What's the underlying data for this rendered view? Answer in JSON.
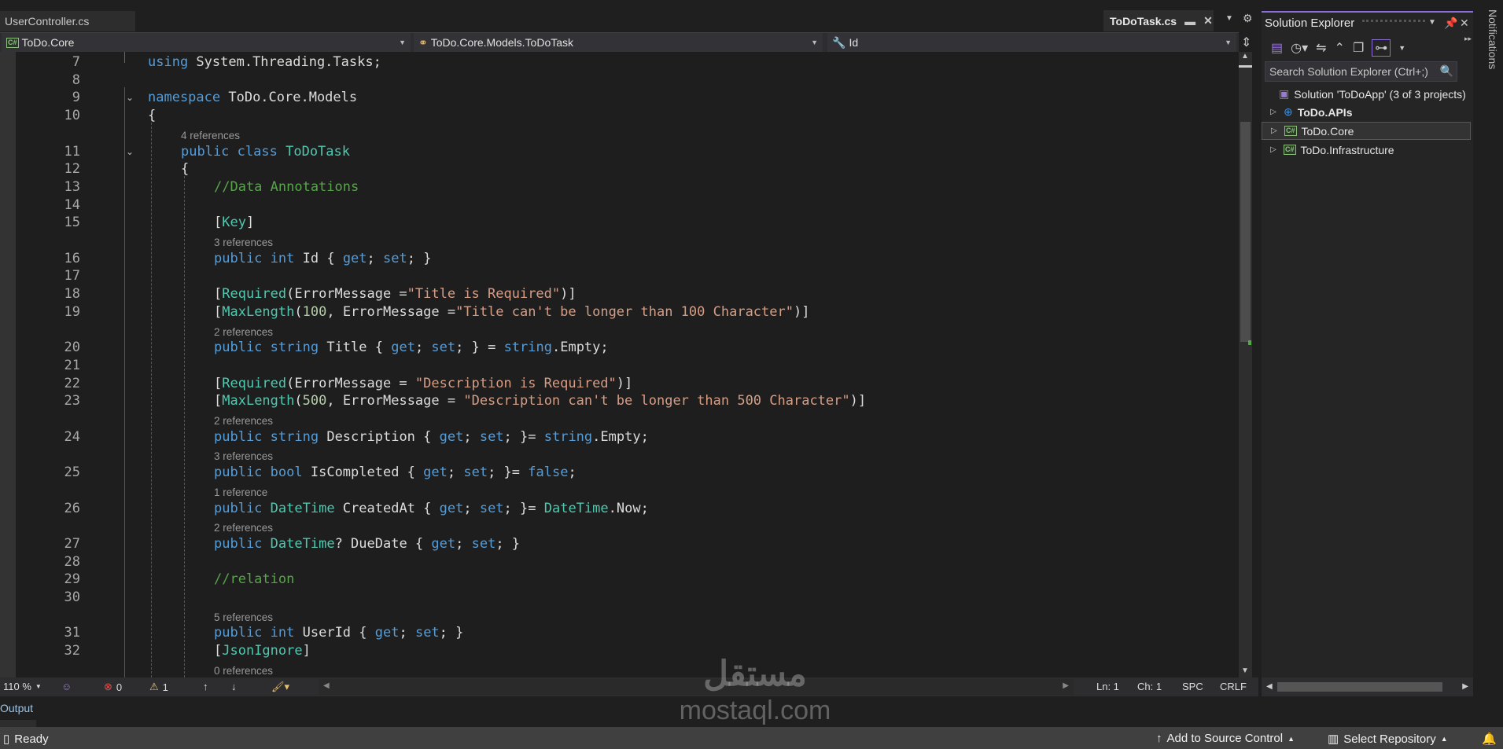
{
  "tabs": {
    "inactive": "UserController.cs",
    "active": "ToDoTask.cs"
  },
  "navbar": {
    "project": "ToDo.Core",
    "type": "ToDo.Core.Models.ToDoTask",
    "member": "Id"
  },
  "code_rows": [
    {
      "n": "7",
      "i": 0,
      "t": [
        [
          "using",
          "kw"
        ],
        [
          " System.Threading.Tasks;",
          "pl"
        ]
      ]
    },
    {
      "n": "8",
      "i": 0,
      "t": []
    },
    {
      "n": "9",
      "i": 0,
      "fold": true,
      "t": [
        [
          "namespace",
          "kw"
        ],
        [
          " ToDo.Core.Models",
          "pl"
        ]
      ]
    },
    {
      "n": "10",
      "i": 0,
      "t": [
        [
          "{",
          "pl"
        ]
      ]
    },
    {
      "lens": "4 references",
      "i": 1
    },
    {
      "n": "11",
      "i": 1,
      "fold": true,
      "t": [
        [
          "public",
          "kw"
        ],
        [
          " ",
          "pl"
        ],
        [
          "class",
          "kw"
        ],
        [
          " ",
          "pl"
        ],
        [
          "ToDoTask",
          "type"
        ]
      ]
    },
    {
      "n": "12",
      "i": 1,
      "t": [
        [
          "{",
          "pl"
        ]
      ]
    },
    {
      "n": "13",
      "i": 2,
      "t": [
        [
          "//Data Annotations",
          "cm"
        ]
      ]
    },
    {
      "n": "14",
      "i": 2,
      "t": []
    },
    {
      "n": "15",
      "i": 2,
      "t": [
        [
          "[",
          "pl"
        ],
        [
          "Key",
          "type"
        ],
        [
          "]",
          "pl"
        ]
      ]
    },
    {
      "lens": "3 references",
      "i": 2
    },
    {
      "n": "16",
      "i": 2,
      "t": [
        [
          "public",
          "kw"
        ],
        [
          " ",
          "pl"
        ],
        [
          "int",
          "kw"
        ],
        [
          " Id { ",
          "pl"
        ],
        [
          "get",
          "kw"
        ],
        [
          "; ",
          "pl"
        ],
        [
          "set",
          "kw"
        ],
        [
          "; }",
          "pl"
        ]
      ]
    },
    {
      "n": "17",
      "i": 2,
      "t": []
    },
    {
      "n": "18",
      "i": 2,
      "t": [
        [
          "[",
          "pl"
        ],
        [
          "Required",
          "type"
        ],
        [
          "(ErrorMessage =",
          "pl"
        ],
        [
          "\"Title is Required\"",
          "str"
        ],
        [
          ")]",
          "pl"
        ]
      ]
    },
    {
      "n": "19",
      "i": 2,
      "t": [
        [
          "[",
          "pl"
        ],
        [
          "MaxLength",
          "type"
        ],
        [
          "(",
          "pl"
        ],
        [
          "100",
          "num"
        ],
        [
          ", ErrorMessage =",
          "pl"
        ],
        [
          "\"Title can't be longer than 100 Character\"",
          "str"
        ],
        [
          ")]",
          "pl"
        ]
      ]
    },
    {
      "lens": "2 references",
      "i": 2
    },
    {
      "n": "20",
      "i": 2,
      "t": [
        [
          "public",
          "kw"
        ],
        [
          " ",
          "pl"
        ],
        [
          "string",
          "kw"
        ],
        [
          " Title { ",
          "pl"
        ],
        [
          "get",
          "kw"
        ],
        [
          "; ",
          "pl"
        ],
        [
          "set",
          "kw"
        ],
        [
          "; } = ",
          "pl"
        ],
        [
          "string",
          "kw"
        ],
        [
          ".Empty;",
          "pl"
        ]
      ]
    },
    {
      "n": "21",
      "i": 2,
      "t": []
    },
    {
      "n": "22",
      "i": 2,
      "t": [
        [
          "[",
          "pl"
        ],
        [
          "Required",
          "type"
        ],
        [
          "(ErrorMessage = ",
          "pl"
        ],
        [
          "\"Description is Required\"",
          "str"
        ],
        [
          ")]",
          "pl"
        ]
      ]
    },
    {
      "n": "23",
      "i": 2,
      "t": [
        [
          "[",
          "pl"
        ],
        [
          "MaxLength",
          "type"
        ],
        [
          "(",
          "pl"
        ],
        [
          "500",
          "num"
        ],
        [
          ", ErrorMessage = ",
          "pl"
        ],
        [
          "\"Description can't be longer than 500 Character\"",
          "str"
        ],
        [
          ")]",
          "pl"
        ]
      ]
    },
    {
      "lens": "2 references",
      "i": 2
    },
    {
      "n": "24",
      "i": 2,
      "t": [
        [
          "public",
          "kw"
        ],
        [
          " ",
          "pl"
        ],
        [
          "string",
          "kw"
        ],
        [
          " Description { ",
          "pl"
        ],
        [
          "get",
          "kw"
        ],
        [
          "; ",
          "pl"
        ],
        [
          "set",
          "kw"
        ],
        [
          "; }= ",
          "pl"
        ],
        [
          "string",
          "kw"
        ],
        [
          ".Empty;",
          "pl"
        ]
      ]
    },
    {
      "lens": "3 references",
      "i": 2
    },
    {
      "n": "25",
      "i": 2,
      "t": [
        [
          "public",
          "kw"
        ],
        [
          " ",
          "pl"
        ],
        [
          "bool",
          "kw"
        ],
        [
          " IsCompleted { ",
          "pl"
        ],
        [
          "get",
          "kw"
        ],
        [
          "; ",
          "pl"
        ],
        [
          "set",
          "kw"
        ],
        [
          "; }= ",
          "pl"
        ],
        [
          "false",
          "kw"
        ],
        [
          ";",
          "pl"
        ]
      ]
    },
    {
      "lens": "1 reference",
      "i": 2
    },
    {
      "n": "26",
      "i": 2,
      "t": [
        [
          "public",
          "kw"
        ],
        [
          " ",
          "pl"
        ],
        [
          "DateTime",
          "type"
        ],
        [
          " CreatedAt { ",
          "pl"
        ],
        [
          "get",
          "kw"
        ],
        [
          "; ",
          "pl"
        ],
        [
          "set",
          "kw"
        ],
        [
          "; }= ",
          "pl"
        ],
        [
          "DateTime",
          "type"
        ],
        [
          ".Now;",
          "pl"
        ]
      ]
    },
    {
      "lens": "2 references",
      "i": 2
    },
    {
      "n": "27",
      "i": 2,
      "t": [
        [
          "public",
          "kw"
        ],
        [
          " ",
          "pl"
        ],
        [
          "DateTime",
          "type"
        ],
        [
          "? DueDate { ",
          "pl"
        ],
        [
          "get",
          "kw"
        ],
        [
          "; ",
          "pl"
        ],
        [
          "set",
          "kw"
        ],
        [
          "; }",
          "pl"
        ]
      ]
    },
    {
      "n": "28",
      "i": 2,
      "t": []
    },
    {
      "n": "29",
      "i": 2,
      "t": [
        [
          "//relation",
          "cm"
        ]
      ]
    },
    {
      "n": "30",
      "i": 2,
      "t": []
    },
    {
      "lens": "5 references",
      "i": 2
    },
    {
      "n": "31",
      "i": 2,
      "t": [
        [
          "public",
          "kw"
        ],
        [
          " ",
          "pl"
        ],
        [
          "int",
          "kw"
        ],
        [
          " UserId { ",
          "pl"
        ],
        [
          "get",
          "kw"
        ],
        [
          "; ",
          "pl"
        ],
        [
          "set",
          "kw"
        ],
        [
          "; }",
          "pl"
        ]
      ]
    },
    {
      "n": "32",
      "i": 2,
      "t": [
        [
          "[",
          "pl"
        ],
        [
          "JsonIgnore",
          "type"
        ],
        [
          "]",
          "pl"
        ]
      ]
    },
    {
      "lens": "0 references",
      "i": 2
    }
  ],
  "editor_status": {
    "zoom": "110 %",
    "errors": "0",
    "warnings": "1",
    "line": "Ln: 1",
    "col": "Ch: 1",
    "spacing": "SPC",
    "eol": "CRLF"
  },
  "output_label": "Output",
  "statusbar": {
    "ready": "Ready",
    "source_control": "Add to Source Control",
    "repository": "Select Repository"
  },
  "solution_explorer": {
    "title": "Solution Explorer",
    "search_placeholder": "Search Solution Explorer (Ctrl+;)",
    "solution": "Solution 'ToDoApp' (3 of 3 projects)",
    "projects": [
      "ToDo.APIs",
      "ToDo.Core",
      "ToDo.Infrastructure"
    ]
  },
  "notifications_label": "Notifications",
  "watermark": {
    "arabic": "مستقل",
    "latin": "mostaql.com"
  },
  "colors": {
    "keyword": "#569cd6",
    "type": "#4ec9b0",
    "string": "#d69d85",
    "number": "#b5cea8",
    "comment": "#57a64a",
    "accent": "#8b6cd9"
  }
}
